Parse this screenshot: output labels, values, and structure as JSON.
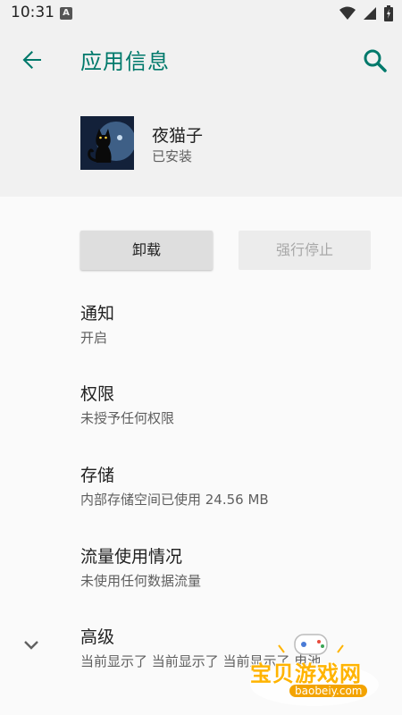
{
  "status_bar": {
    "time": "10:31",
    "notification_letter": "A"
  },
  "app_bar": {
    "title": "应用信息"
  },
  "app": {
    "name": "夜猫子",
    "install_status": "已安装"
  },
  "buttons": {
    "uninstall": "卸载",
    "force_stop": "强行停止"
  },
  "settings": [
    {
      "title": "通知",
      "subtitle": "开启"
    },
    {
      "title": "权限",
      "subtitle": "未授予任何权限"
    },
    {
      "title": "存储",
      "subtitle": "内部存储空间已使用 24.56 MB"
    },
    {
      "title": "流量使用情况",
      "subtitle": "未使用任何数据流量"
    },
    {
      "title": "高级",
      "subtitle": "当前显示了 当前显示了 当前显示了 电池"
    }
  ],
  "watermark": {
    "text": "宝贝游戏网",
    "url": "baobeiy.com"
  },
  "colors": {
    "accent": "#00796b",
    "header_bg": "#f1f1f1",
    "page_bg": "#fafafa"
  }
}
